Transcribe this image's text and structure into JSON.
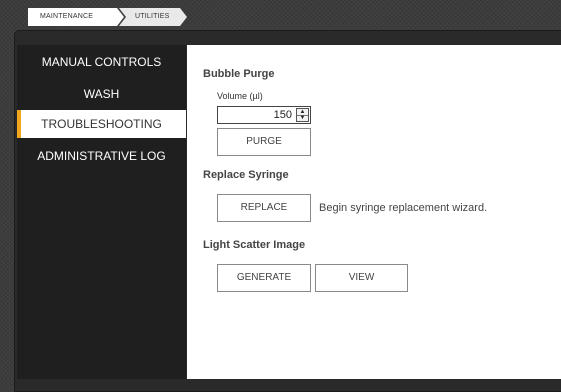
{
  "breadcrumb": {
    "items": [
      "MAINTENANCE",
      "UTILITIES"
    ]
  },
  "sidebar": {
    "items": [
      {
        "label": "MANUAL CONTROLS"
      },
      {
        "label": "WASH"
      },
      {
        "label": "TROUBLESHOOTING"
      },
      {
        "label": "ADMINISTRATIVE LOG"
      }
    ],
    "active_index": 2,
    "accent_color": "#f2a71e"
  },
  "bubble_purge": {
    "title": "Bubble Purge",
    "volume_label": "Volume (µl)",
    "volume_value": "150",
    "purge_label": "PURGE"
  },
  "replace_syringe": {
    "title": "Replace Syringe",
    "button_label": "REPLACE",
    "description": "Begin syringe replacement wizard."
  },
  "light_scatter": {
    "title": "Light Scatter Image",
    "generate_label": "GENERATE",
    "view_label": "VIEW"
  }
}
